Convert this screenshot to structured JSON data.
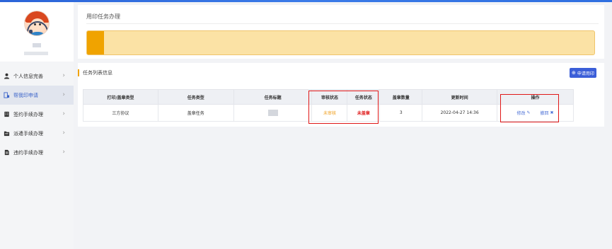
{
  "sidebar": {
    "items": [
      {
        "label": "个人信息完善",
        "icon": "user-icon",
        "active": false
      },
      {
        "label": "帮我印申请",
        "icon": "stamp-icon",
        "active": true
      },
      {
        "label": "签约手续办理",
        "icon": "building-icon",
        "active": false
      },
      {
        "label": "派遣手续办理",
        "icon": "folder-icon",
        "active": false
      },
      {
        "label": "违约手续办理",
        "icon": "document-icon",
        "active": false
      }
    ]
  },
  "header": {
    "title": "用印任务办理"
  },
  "banner": {
    "progress": 0.033,
    "color": "#f0a300",
    "background": "#fbe2a5"
  },
  "list": {
    "title": "任务列表信息",
    "apply_button": "申请用印",
    "columns": [
      "打印/盖章类型",
      "任务类型",
      "任务标题",
      "审核状态",
      "任务状态",
      "盖章数量",
      "更新时间",
      "操作"
    ],
    "rows": [
      {
        "print_type": "三方协议",
        "task_type": "盖章任务",
        "audit_status": "未审核",
        "task_status": "未盖章",
        "seal_count": "3",
        "updated": "2022-04-27 14:36",
        "actions": {
          "edit": "修改",
          "withdraw": "撤回"
        }
      }
    ]
  },
  "colors": {
    "accent": "#3b5ed8",
    "pending": "#f0a020",
    "unsealed": "#e02020",
    "highlight_box": "#e01818"
  }
}
